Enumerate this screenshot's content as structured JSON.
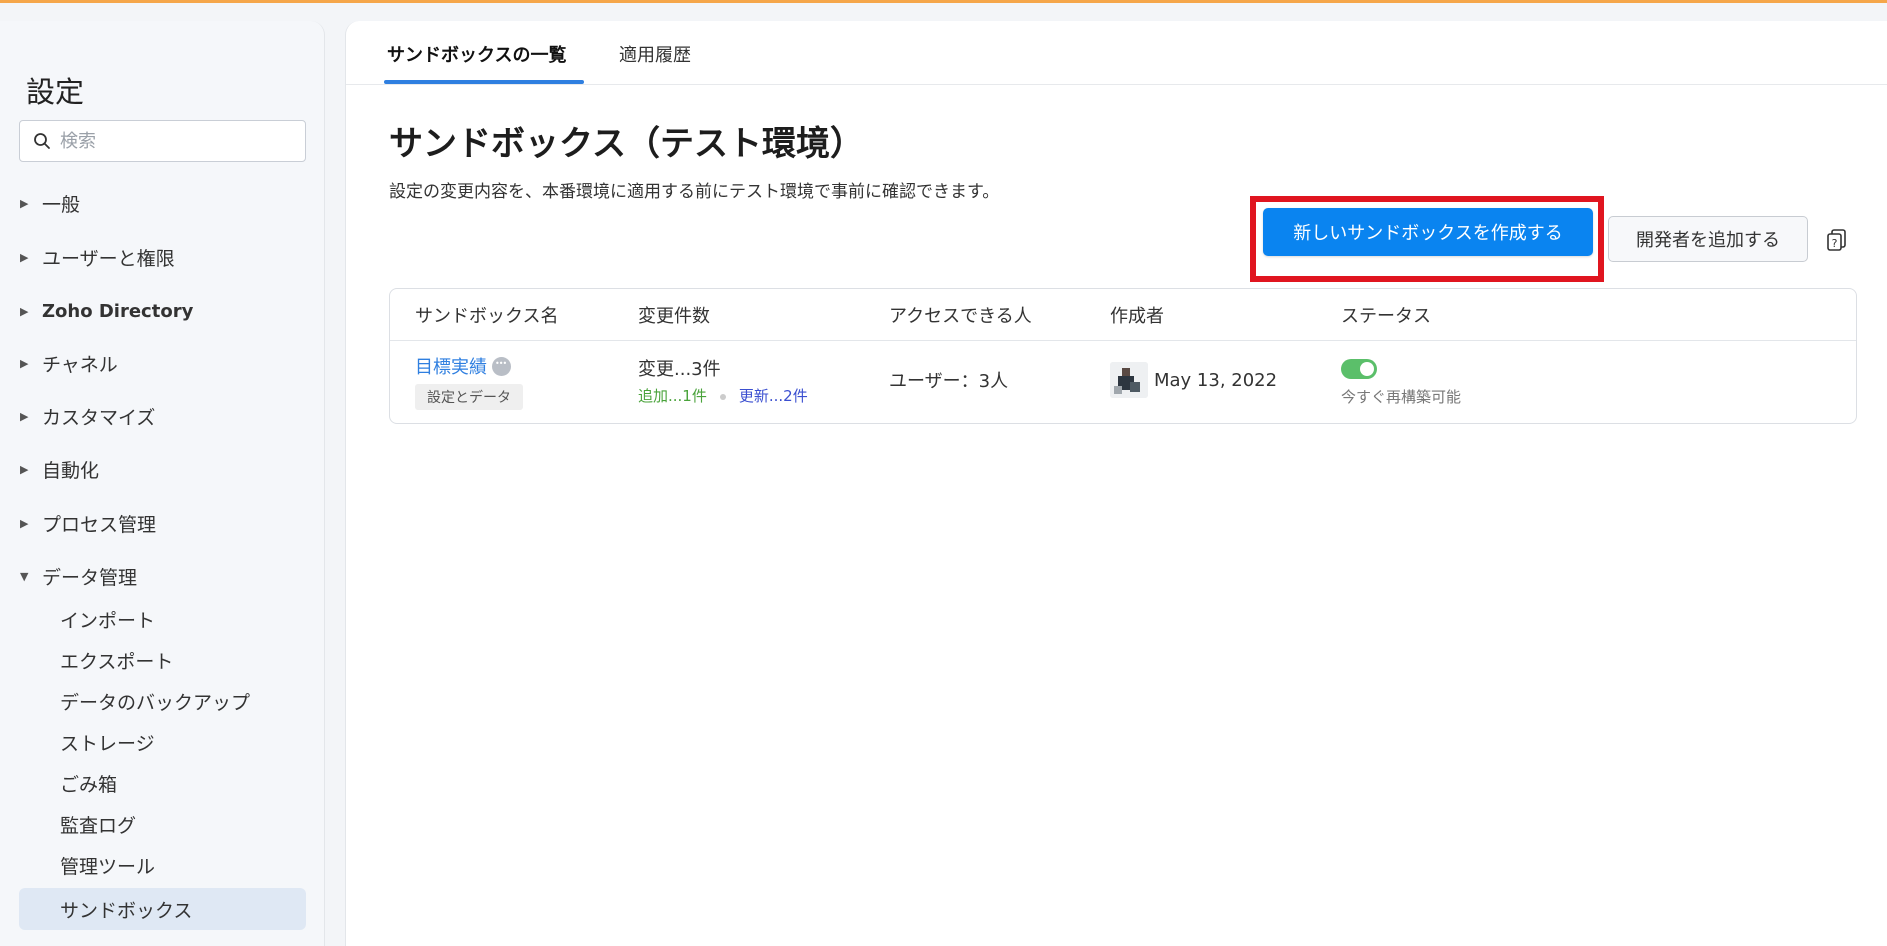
{
  "sidebar": {
    "title": "設定",
    "search_placeholder": "検索",
    "sections": [
      {
        "label": "一般"
      },
      {
        "label": "ユーザーと権限"
      },
      {
        "label": "Zoho Directory"
      },
      {
        "label": "チャネル"
      },
      {
        "label": "カスタマイズ"
      },
      {
        "label": "自動化"
      },
      {
        "label": "プロセス管理"
      },
      {
        "label": "データ管理"
      }
    ],
    "data_children": [
      {
        "label": "インポート"
      },
      {
        "label": "エクスポート"
      },
      {
        "label": "データのバックアップ"
      },
      {
        "label": "ストレージ"
      },
      {
        "label": "ごみ箱"
      },
      {
        "label": "監査ログ"
      },
      {
        "label": "管理ツール"
      },
      {
        "label": "サンドボックス"
      }
    ]
  },
  "tabs": [
    {
      "label": "サンドボックスの一覧"
    },
    {
      "label": "適用履歴"
    }
  ],
  "page": {
    "title": "サンドボックス（テスト環境）",
    "description": "設定の変更内容を、本番環境に適用する前にテスト環境で事前に確認できます。",
    "primary_button": "新しいサンドボックスを作成する",
    "secondary_button": "開発者を追加する"
  },
  "table": {
    "headers": [
      "サンドボックス名",
      "変更件数",
      "アクセスできる人",
      "作成者",
      "ステータス"
    ],
    "rows": [
      {
        "name": "目標実績",
        "tag": "設定とデータ",
        "changes": "変更...3件",
        "added": "追加...1件",
        "updated": "更新...2件",
        "access": "ユーザー：3人",
        "created": "May 13, 2022",
        "status": "今すぐ再構築可能"
      }
    ]
  },
  "colors": {
    "accent": "#0a84f0",
    "highlight": "#e0151f",
    "toggle_on": "#5bbf6a",
    "added": "#4aa33b",
    "updated": "#3b4fd0"
  }
}
